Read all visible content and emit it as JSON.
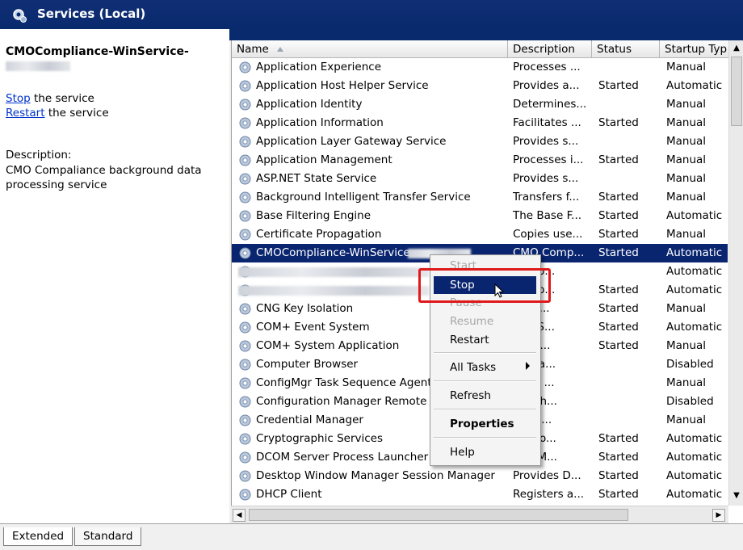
{
  "window": {
    "title": "Services (Local)"
  },
  "left_pane": {
    "service_name": "CMOCompliance-WinService-",
    "stop_link": "Stop",
    "stop_suffix": " the service",
    "restart_link": "Restart",
    "restart_suffix": " the service",
    "description_label": "Description:",
    "description_text": "CMO Compaliance background data processing service"
  },
  "table": {
    "columns": {
      "name": "Name",
      "description": "Description",
      "status": "Status",
      "startup": "Startup Typ"
    },
    "rows": [
      {
        "name": "Application Experience",
        "description": "Processes ...",
        "status": "",
        "startup": "Manual"
      },
      {
        "name": "Application Host Helper Service",
        "description": "Provides a...",
        "status": "Started",
        "startup": "Automatic"
      },
      {
        "name": "Application Identity",
        "description": "Determines...",
        "status": "",
        "startup": "Manual"
      },
      {
        "name": "Application Information",
        "description": "Facilitates ...",
        "status": "Started",
        "startup": "Manual"
      },
      {
        "name": "Application Layer Gateway Service",
        "description": "Provides s...",
        "status": "",
        "startup": "Manual"
      },
      {
        "name": "Application Management",
        "description": "Processes i...",
        "status": "Started",
        "startup": "Manual"
      },
      {
        "name": "ASP.NET State Service",
        "description": "Provides s...",
        "status": "",
        "startup": "Manual"
      },
      {
        "name": "Background Intelligent Transfer Service",
        "description": "Transfers f...",
        "status": "Started",
        "startup": "Manual"
      },
      {
        "name": "Base Filtering Engine",
        "description": "The Base F...",
        "status": "Started",
        "startup": "Automatic"
      },
      {
        "name": "Certificate Propagation",
        "description": "Copies use...",
        "status": "Started",
        "startup": "Manual"
      },
      {
        "name": "CMOCompliance-WinService-",
        "description": "CMO Comp...",
        "status": "Started",
        "startup": "Automatic"
      },
      {
        "name": "",
        "description": "Comp...",
        "status": "",
        "startup": "Automatic"
      },
      {
        "name": "",
        "description": "Comp...",
        "status": "Started",
        "startup": "Automatic"
      },
      {
        "name": "CNG Key Isolation",
        "description": "NG k...",
        "status": "Started",
        "startup": "Manual"
      },
      {
        "name": "COM+ Event System",
        "description": "orts S...",
        "status": "Started",
        "startup": "Automatic"
      },
      {
        "name": "COM+ System Application",
        "description": "ges t...",
        "status": "Started",
        "startup": "Manual"
      },
      {
        "name": "Computer Browser",
        "description": "ains a...",
        "status": "",
        "startup": "Disabled"
      },
      {
        "name": "ConfigMgr Task Sequence Agent",
        "description": "gMgr ...",
        "status": "",
        "startup": "Manual"
      },
      {
        "name": "Configuration Manager Remote C",
        "description": "des th...",
        "status": "",
        "startup": "Disabled"
      },
      {
        "name": "Credential Manager",
        "description": "des s...",
        "status": "",
        "startup": "Manual"
      },
      {
        "name": "Cryptographic Services",
        "description": "des fo...",
        "status": "Started",
        "startup": "Automatic"
      },
      {
        "name": "DCOM Server Process Launcher",
        "description": "DCOM...",
        "status": "Started",
        "startup": "Automatic"
      },
      {
        "name": "Desktop Window Manager Session Manager",
        "description": "Provides D...",
        "status": "Started",
        "startup": "Automatic"
      },
      {
        "name": "DHCP Client",
        "description": "Registers a...",
        "status": "Started",
        "startup": "Automatic"
      }
    ]
  },
  "context_menu": {
    "start": "Start",
    "stop": "Stop",
    "pause": "Pause",
    "resume": "Resume",
    "restart": "Restart",
    "all_tasks": "All Tasks",
    "refresh": "Refresh",
    "properties": "Properties",
    "help": "Help"
  },
  "tabs": {
    "extended": "Extended",
    "standard": "Standard"
  },
  "colors": {
    "header": "#0a2a6e",
    "selection": "#0a2570",
    "highlight_box": "#e0191b"
  }
}
